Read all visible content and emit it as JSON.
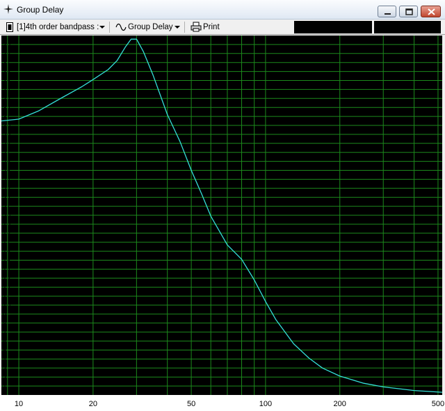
{
  "window": {
    "title": "Group Delay",
    "min_label": "minimize",
    "max_label": "maximize",
    "close_label": "close"
  },
  "toolbar": {
    "enclosure_label": "[1]4th order bandpass :",
    "view_label": "Group Delay",
    "print_label": "Print"
  },
  "colors": {
    "plot_bg": "#000000",
    "grid": "#1c8a1c",
    "trace": "#34e0d8"
  },
  "chart_data": {
    "type": "line",
    "x_scale": "log",
    "xlim": [
      8.5,
      520
    ],
    "ylim": [
      0,
      40
    ],
    "y_ticks": [
      1,
      2,
      3,
      4,
      5,
      6,
      7,
      8,
      9,
      10,
      11,
      12,
      13,
      14,
      15,
      16,
      17,
      18,
      19,
      20,
      21,
      22,
      23,
      24,
      25,
      26,
      27,
      28,
      29,
      30,
      31,
      32,
      33,
      34,
      35,
      36,
      37,
      38,
      39
    ],
    "x_ticks": [
      10,
      20,
      50,
      100,
      200,
      500
    ],
    "x_grid": [
      9,
      10,
      20,
      30,
      40,
      50,
      60,
      70,
      80,
      90,
      100,
      200,
      300,
      400,
      500
    ],
    "grid": true,
    "series": [
      {
        "x": [
          8.5,
          10,
          12,
          15,
          18,
          20,
          23,
          25,
          27,
          28.5,
          30,
          32,
          35,
          40,
          45,
          50,
          55,
          60,
          70,
          80,
          90,
          100,
          110,
          130,
          150,
          170,
          200,
          250,
          300,
          400,
          520
        ],
        "y": [
          30.5,
          30.7,
          31.6,
          33.1,
          34.3,
          35.1,
          36.2,
          37.2,
          38.7,
          39.6,
          39.6,
          38.2,
          35.6,
          31.2,
          28.2,
          25.0,
          22.4,
          19.9,
          16.7,
          15.1,
          12.8,
          10.4,
          8.4,
          5.7,
          4.1,
          3.0,
          2.1,
          1.3,
          0.9,
          0.5,
          0.3
        ]
      }
    ]
  }
}
